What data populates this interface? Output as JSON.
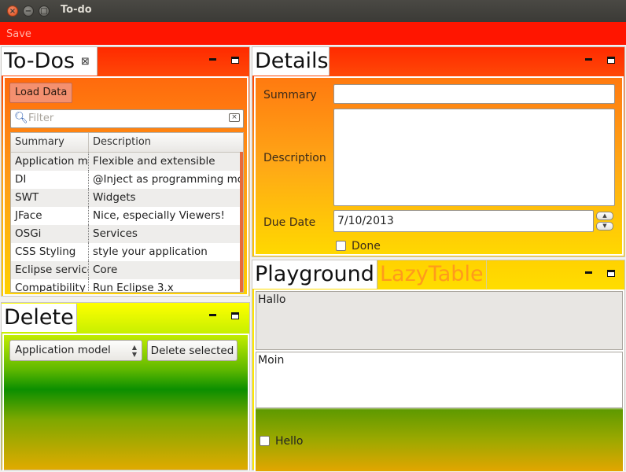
{
  "window": {
    "title": "To-do"
  },
  "toolbar": {
    "save_label": "Save"
  },
  "colors": {
    "toolbar": "#ff1500",
    "tab_inactive_text": "#ff9a1c"
  },
  "todos": {
    "tab_label": "To-Dos",
    "load_button": "Load Data",
    "filter_placeholder": "Filter",
    "columns": [
      "Summary",
      "Description"
    ],
    "rows": [
      [
        "Application model",
        "Flexible and extensible"
      ],
      [
        "DI",
        "@Inject as programming model"
      ],
      [
        "SWT",
        "Widgets"
      ],
      [
        "JFace",
        "Nice, especially Viewers!"
      ],
      [
        "OSGi",
        "Services"
      ],
      [
        "CSS Styling",
        "style your application"
      ],
      [
        "Eclipse services",
        "Core"
      ],
      [
        "Compatibility",
        "Run Eclipse 3.x"
      ]
    ]
  },
  "delete": {
    "tab_label": "Delete",
    "combo_value": "Application model",
    "delete_button": "Delete selected"
  },
  "details": {
    "tab_label": "Details",
    "summary_label": "Summary",
    "description_label": "Description",
    "due_date_label": "Due Date",
    "due_date_value": "7/10/2013",
    "done_label": "Done"
  },
  "playground": {
    "tabs": [
      "Playground",
      "LazyTable"
    ],
    "box1": "Hallo",
    "box2": "Moin",
    "check_label": "Hello"
  }
}
